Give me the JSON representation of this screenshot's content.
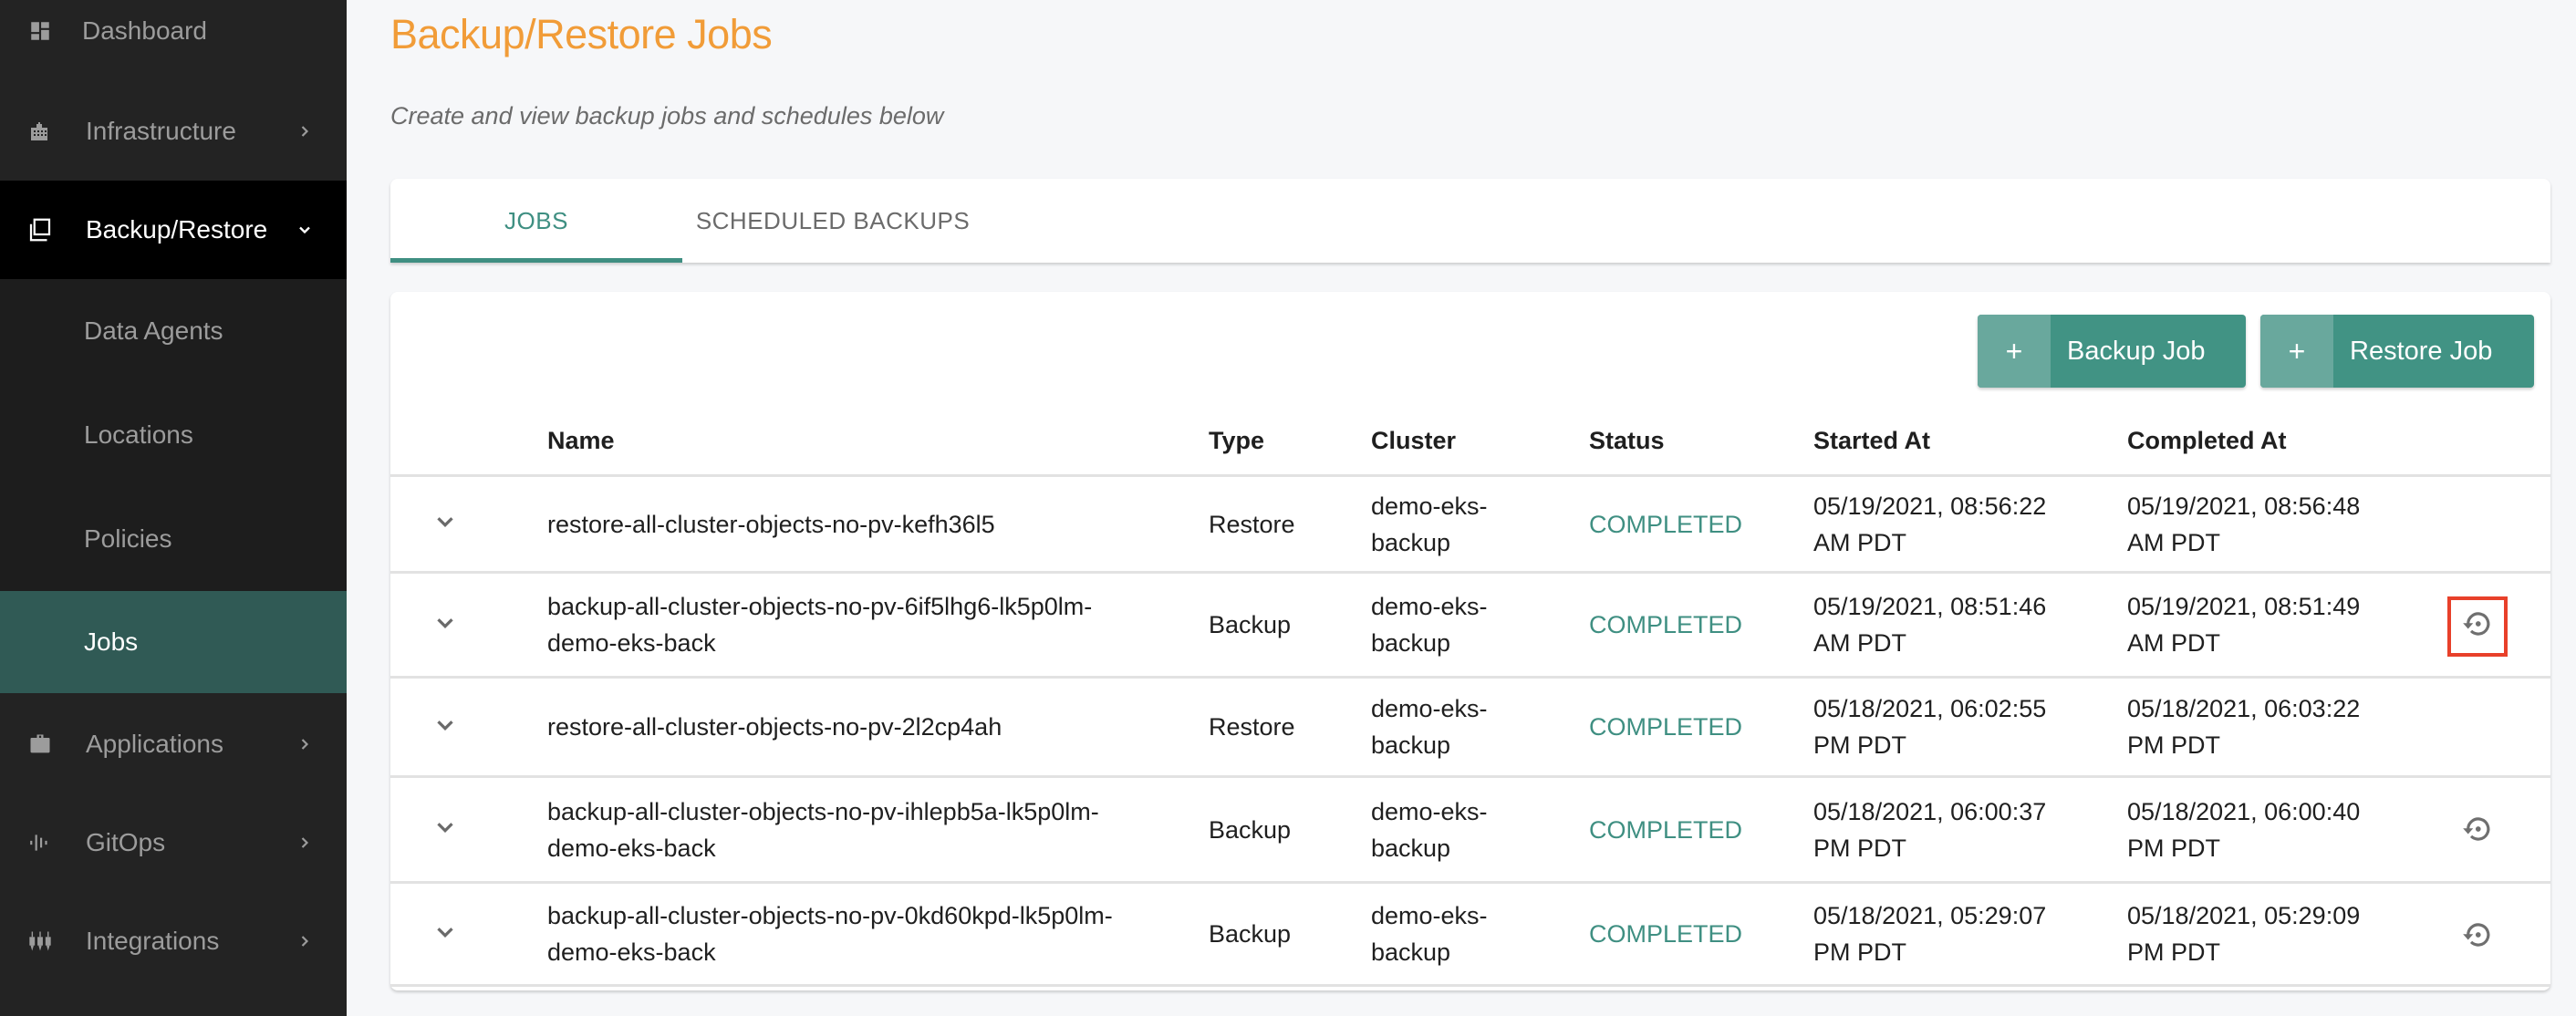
{
  "sidebar": {
    "items": [
      {
        "label": "Dashboard",
        "icon": "dashboard-icon",
        "has_chevron": false
      },
      {
        "label": "Infrastructure",
        "icon": "building-icon",
        "has_chevron": true
      },
      {
        "label": "Backup/Restore",
        "icon": "copy-icon",
        "has_chevron": true,
        "expanded": true
      },
      {
        "label": "Applications",
        "icon": "briefcase-icon",
        "has_chevron": true
      },
      {
        "label": "GitOps",
        "icon": "waveform-icon",
        "has_chevron": true
      },
      {
        "label": "Integrations",
        "icon": "plugs-icon",
        "has_chevron": true
      }
    ],
    "sub_items": [
      {
        "label": "Data Agents"
      },
      {
        "label": "Locations"
      },
      {
        "label": "Policies"
      },
      {
        "label": "Jobs",
        "active": true
      }
    ]
  },
  "header": {
    "title": "Backup/Restore Jobs",
    "subtitle": "Create and view backup jobs and schedules below"
  },
  "tabs": [
    {
      "label": "JOBS",
      "active": true
    },
    {
      "label": "SCHEDULED BACKUPS",
      "active": false
    }
  ],
  "actions": {
    "backup_job": {
      "icon": "+",
      "label": "Backup Job"
    },
    "restore_job": {
      "icon": "+",
      "label": "Restore Job"
    }
  },
  "table": {
    "columns": [
      "Name",
      "Type",
      "Cluster",
      "Status",
      "Started At",
      "Completed At"
    ],
    "rows": [
      {
        "name": "restore-all-cluster-objects-no-pv-kefh36l5",
        "type": "Restore",
        "cluster": "demo-eks-backup",
        "status": "COMPLETED",
        "started_at": "05/19/2021, 08:56:22 AM PDT",
        "completed_at": "05/19/2021, 08:56:48 AM PDT",
        "has_restore_action": false
      },
      {
        "name": "backup-all-cluster-objects-no-pv-6if5lhg6-lk5p0lm-demo-eks-back",
        "type": "Backup",
        "cluster": "demo-eks-backup",
        "status": "COMPLETED",
        "started_at": "05/19/2021, 08:51:46 AM PDT",
        "completed_at": "05/19/2021, 08:51:49 AM PDT",
        "has_restore_action": true,
        "highlighted": true
      },
      {
        "name": "restore-all-cluster-objects-no-pv-2l2cp4ah",
        "type": "Restore",
        "cluster": "demo-eks-backup",
        "status": "COMPLETED",
        "started_at": "05/18/2021, 06:02:55 PM PDT",
        "completed_at": "05/18/2021, 06:03:22 PM PDT",
        "has_restore_action": false
      },
      {
        "name": "backup-all-cluster-objects-no-pv-ihlepb5a-lk5p0lm-demo-eks-back",
        "type": "Backup",
        "cluster": "demo-eks-backup",
        "status": "COMPLETED",
        "started_at": "05/18/2021, 06:00:37 PM PDT",
        "completed_at": "05/18/2021, 06:00:40 PM PDT",
        "has_restore_action": true
      },
      {
        "name": "backup-all-cluster-objects-no-pv-0kd60kpd-lk5p0lm-demo-eks-back",
        "type": "Backup",
        "cluster": "demo-eks-backup",
        "status": "COMPLETED",
        "started_at": "05/18/2021, 05:29:07 PM PDT",
        "completed_at": "05/18/2021, 05:29:09 PM PDT",
        "has_restore_action": true
      }
    ]
  },
  "colors": {
    "accent": "#419384",
    "title": "#f19c38",
    "status_completed": "#3f8f82",
    "highlight": "#e8402a"
  }
}
